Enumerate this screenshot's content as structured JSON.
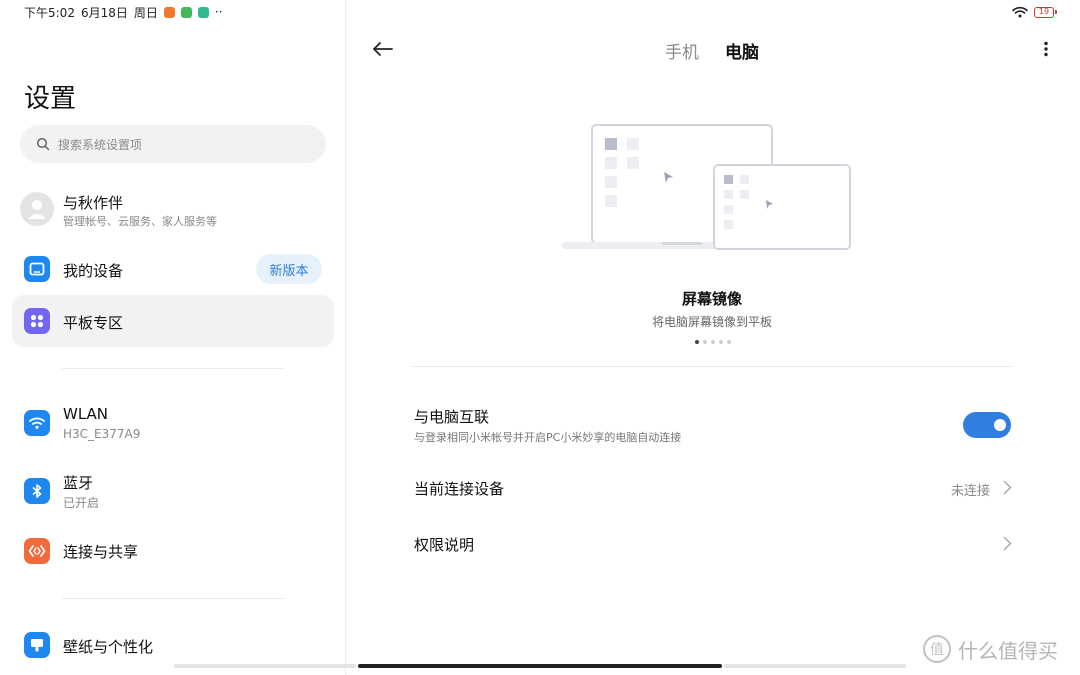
{
  "status_bar": {
    "time": "下午5:02",
    "date": "6月18日",
    "weekday": "周日",
    "more": "··",
    "battery": "19"
  },
  "sidebar": {
    "title": "设置",
    "search_placeholder": "搜索系统设置项",
    "account": {
      "name": "与秋作伴",
      "sub": "管理帐号、云服务、家人服务等"
    },
    "items": [
      {
        "label": "我的设备",
        "badge": "新版本",
        "icon": "tablet-icon",
        "color": "#1e88f0"
      },
      {
        "label": "平板专区",
        "icon": "grid-icon",
        "color": "#7367f0"
      },
      {
        "label": "WLAN",
        "sub": "H3C_E377A9",
        "icon": "wifi-icon",
        "color": "#1e88f0"
      },
      {
        "label": "蓝牙",
        "sub": "已开启",
        "icon": "bluetooth-icon",
        "color": "#1e88f0"
      },
      {
        "label": "连接与共享",
        "icon": "share-icon",
        "color": "#f26b3a"
      },
      {
        "label": "壁纸与个性化",
        "icon": "palette-icon",
        "color": "#1e88f0"
      }
    ]
  },
  "main": {
    "tabs": [
      {
        "label": "手机",
        "active": false
      },
      {
        "label": "电脑",
        "active": true
      }
    ],
    "feature": {
      "title": "屏幕镜像",
      "desc": "将电脑屏幕镜像到平板",
      "pages": 5,
      "current_page": 1
    },
    "settings": [
      {
        "title": "与电脑互联",
        "sub": "与登录相同小米帐号并开启PC小米妙享的电脑自动连接",
        "toggle": true
      },
      {
        "title": "当前连接设备",
        "value": "未连接"
      },
      {
        "title": "权限说明"
      }
    ]
  },
  "watermark": "什么值得买",
  "colors": {
    "accent": "#2f7ee0",
    "badge_bg": "#e6f1fc",
    "selected_bg": "#f2f2f2"
  }
}
